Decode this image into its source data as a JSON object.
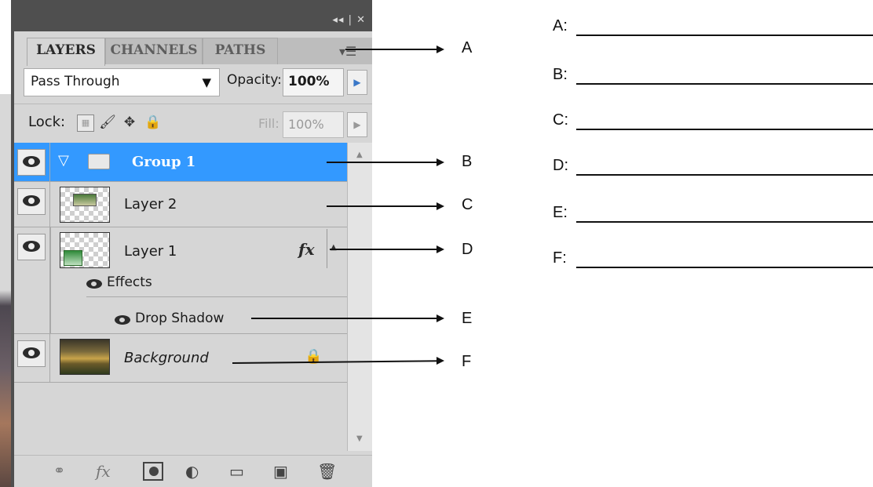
{
  "panel": {
    "titlebar_buttons": "◂◂ | ✕",
    "tabs": [
      "LAYERS",
      "CHANNELS",
      "PATHS"
    ],
    "blend_mode": "Pass Through",
    "opacity_label": "Opacity:",
    "opacity_value": "100%",
    "lock_label": "Lock:",
    "fill_label": "Fill:",
    "fill_value": "100%",
    "layers": [
      {
        "name": "Group 1",
        "selected": true
      },
      {
        "name": "Layer 2"
      },
      {
        "name": "Layer 1",
        "fx": "fx"
      },
      {
        "name": "Effects"
      },
      {
        "name": "Drop Shadow"
      },
      {
        "name": "Background"
      }
    ],
    "bottom_icons": [
      "link-icon",
      "fx-icon",
      "mask-icon",
      "adjustment-icon",
      "folder-icon",
      "new-layer-icon",
      "trash-icon"
    ],
    "bottom_fx_label": "fx"
  },
  "callouts": [
    "A",
    "B",
    "C",
    "D",
    "E",
    "F"
  ],
  "answers": [
    {
      "label": "A:"
    },
    {
      "label": "B:"
    },
    {
      "label": "C:"
    },
    {
      "label": "D:"
    },
    {
      "label": "E:"
    },
    {
      "label": "F:"
    }
  ],
  "colors": {
    "selected_row": "#3399ff",
    "panel_bg": "#d6d6d6",
    "titlebar": "#4f4f4f"
  }
}
